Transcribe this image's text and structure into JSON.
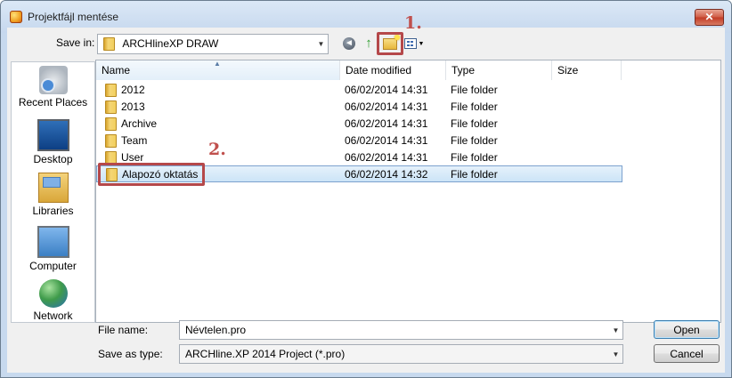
{
  "window": {
    "title": "Projektfájl mentése",
    "close_label": "✕"
  },
  "toolbar": {
    "save_in_label": "Save in:",
    "save_in_value": "ARCHlineXP DRAW",
    "back_glyph": "◄",
    "up_glyph": "↑"
  },
  "places": [
    {
      "label": "Recent Places",
      "icon": "recent-places-icon"
    },
    {
      "label": "Desktop",
      "icon": "desktop-icon"
    },
    {
      "label": "Libraries",
      "icon": "libraries-icon"
    },
    {
      "label": "Computer",
      "icon": "computer-icon"
    },
    {
      "label": "Network",
      "icon": "network-icon"
    }
  ],
  "columns": {
    "name": "Name",
    "date": "Date modified",
    "type": "Type",
    "size": "Size"
  },
  "files": [
    {
      "name": "2012",
      "date": "06/02/2014 14:31",
      "type": "File folder"
    },
    {
      "name": "2013",
      "date": "06/02/2014 14:31",
      "type": "File folder"
    },
    {
      "name": "Archive",
      "date": "06/02/2014 14:31",
      "type": "File folder"
    },
    {
      "name": "Team",
      "date": "06/02/2014 14:31",
      "type": "File folder"
    },
    {
      "name": "User",
      "date": "06/02/2014 14:31",
      "type": "File folder"
    },
    {
      "name": "Alapozó oktatás",
      "date": "06/02/2014 14:32",
      "type": "File folder"
    }
  ],
  "form": {
    "file_name_label": "File name:",
    "file_name_value": "Névtelen.pro",
    "save_type_label": "Save as type:",
    "save_type_value": "ARCHline.XP 2014 Project (*.pro)"
  },
  "buttons": {
    "open": "Open",
    "cancel": "Cancel"
  },
  "annotations": {
    "first": "1.",
    "second": "2."
  },
  "colors": {
    "annotation": "#c0504d",
    "selection": "#cce4f7"
  }
}
